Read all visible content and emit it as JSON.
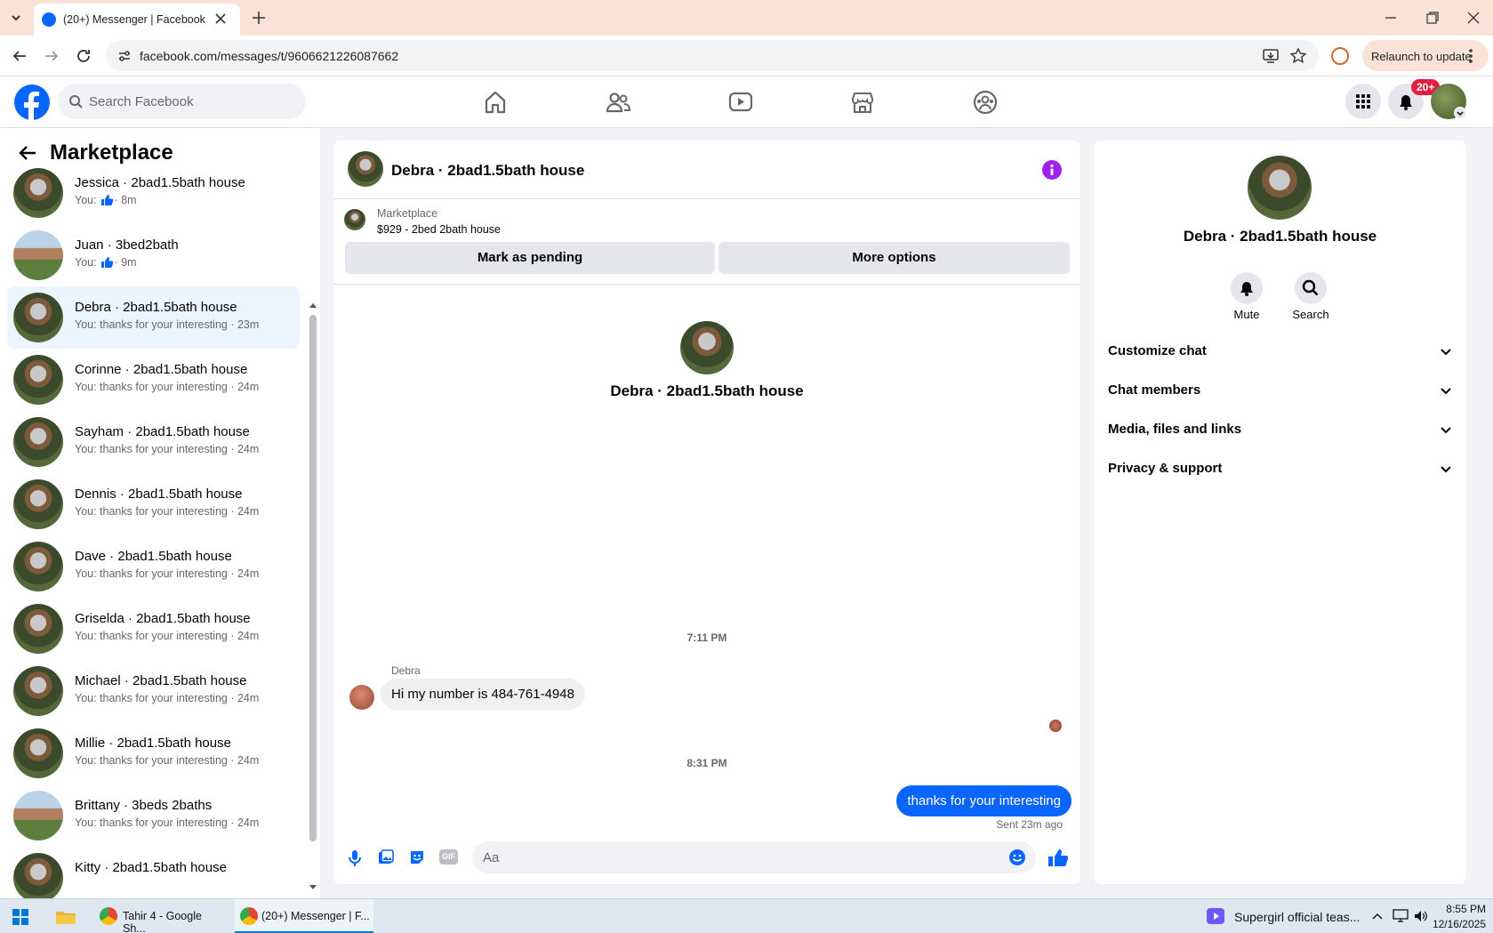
{
  "browser": {
    "tab_title": "(20+) Messenger | Facebook",
    "url": "facebook.com/messages/t/9606621226087662",
    "relaunch_label": "Relaunch to update"
  },
  "fb": {
    "search_placeholder": "Search Facebook",
    "notif_badge": "20+"
  },
  "left": {
    "title": "Marketplace",
    "conversations": [
      {
        "name": "Jessica · 2bad1.5bath house",
        "preview_prefix": "You:",
        "preview_suffix": "· 8m",
        "like": true
      },
      {
        "name": "Juan · 3bed2bath",
        "preview_prefix": "You:",
        "preview_suffix": "· 9m",
        "like": true
      },
      {
        "name": "Debra · 2bad1.5bath house",
        "preview": "You: thanks for your interesting · 23m",
        "active": true
      },
      {
        "name": "Corinne · 2bad1.5bath house",
        "preview": "You: thanks for your interesting · 24m"
      },
      {
        "name": "Sayham · 2bad1.5bath house",
        "preview": "You: thanks for your interesting · 24m"
      },
      {
        "name": "Dennis · 2bad1.5bath house",
        "preview": "You: thanks for your interesting · 24m"
      },
      {
        "name": "Dave · 2bad1.5bath house",
        "preview": "You: thanks for your interesting · 24m"
      },
      {
        "name": "Griselda · 2bad1.5bath house",
        "preview": "You: thanks for your interesting · 24m"
      },
      {
        "name": "Michael · 2bad1.5bath house",
        "preview": "You: thanks for your interesting · 24m"
      },
      {
        "name": "Millie · 2bad1.5bath house",
        "preview": "You: thanks for your interesting · 24m"
      },
      {
        "name": "Brittany · 3beds 2baths",
        "preview": "You: thanks for your interesting · 24m"
      },
      {
        "name": "Kitty · 2bad1.5bath house",
        "preview": ""
      }
    ]
  },
  "chat": {
    "title": "Debra · 2bad1.5bath house",
    "marketplace_label": "Marketplace",
    "listing": "$929 - 2bed 2bath house",
    "mark_pending": "Mark as pending",
    "more_options": "More options",
    "intro_name": "Debra · 2bad1.5bath house",
    "time1": "7:11 PM",
    "sender": "Debra",
    "msg_in": "Hi my number is 484-761-4948",
    "time2": "8:31 PM",
    "msg_out": "thanks for your interesting",
    "sent_status": "Sent 23m ago",
    "composer_placeholder": "Aa"
  },
  "right": {
    "name": "Debra · 2bad1.5bath house",
    "mute": "Mute",
    "search": "Search",
    "sections": [
      "Customize chat",
      "Chat members",
      "Media, files and links",
      "Privacy & support"
    ]
  },
  "taskbar": {
    "app1": "Tahir 4 - Google Sh...",
    "app2": "(20+) Messenger | F...",
    "media": "Supergirl official teas...",
    "time": "8:55 PM",
    "date": "12/16/2025"
  },
  "colors": {
    "fb_blue": "#0866ff",
    "active_row": "#ebf5ff",
    "info_purple": "#a020f0"
  }
}
